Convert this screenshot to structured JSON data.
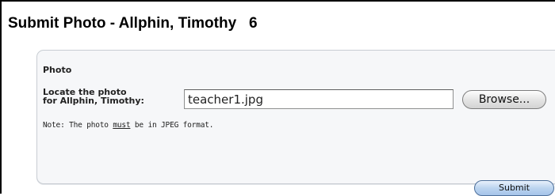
{
  "page": {
    "title": "Submit Photo - Allphin, Timothy   6"
  },
  "panel": {
    "heading": "Photo",
    "field_label_line1": "Locate the photo",
    "field_label_line2": "for Allphin, Timothy:",
    "file_value": "teacher1.jpg",
    "browse_label": "Browse...",
    "note_before": "Note: The photo ",
    "note_emphasis": "must",
    "note_after": " be in JPEG format."
  },
  "actions": {
    "submit_label": "Submit"
  }
}
